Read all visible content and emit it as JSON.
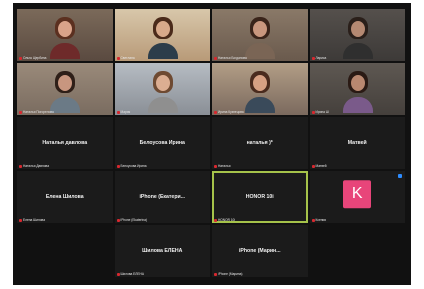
{
  "app": {
    "name": "Zoom gallery view"
  },
  "tiles": [
    {
      "type": "video",
      "name": "Ольга Щербина",
      "bg": "#5a4a40",
      "wall": "#7b6a5a",
      "hair": "#5b3020",
      "face": "#d9a38a",
      "shirt": "#6e2a2a"
    },
    {
      "type": "video",
      "name": "Светлана",
      "bg": "#b89a78",
      "wall": "#d8c7aa",
      "hair": "#4a2a1a",
      "face": "#d8a98a",
      "shirt": "#2c3d4a"
    },
    {
      "type": "video",
      "name": "Наталья Богданова",
      "bg": "#6a5a4d",
      "wall": "#8a7968",
      "hair": "#3a241a",
      "face": "#c9977e",
      "shirt": "#7a6555"
    },
    {
      "type": "video",
      "name": "Лариса",
      "bg": "#3d3a38",
      "wall": "#55504c",
      "hair": "#2a1f1a",
      "face": "#b58972",
      "shirt": "#2f2f2f"
    },
    {
      "type": "video",
      "name": "Наталья Погорелова",
      "bg": "#7a6c60",
      "wall": "#9a8a7a",
      "hair": "#2e1f18",
      "face": "#c8967f",
      "shirt": "#6b7a86"
    },
    {
      "type": "video",
      "name": "Мария",
      "bg": "#8a8f96",
      "wall": "#b6bcc3",
      "hair": "#6e4a32",
      "face": "#dcae92",
      "shirt": "#8f8f8f"
    },
    {
      "type": "video",
      "name": "Ирина Кузнецова",
      "bg": "#7b6a5e",
      "wall": "#b29e86",
      "hair": "#4a2b1e",
      "face": "#d7a184",
      "shirt": "#3a4a5a"
    },
    {
      "type": "video",
      "name": "Ирина Ш",
      "bg": "#45403c",
      "wall": "#5e5852",
      "hair": "#2a1a14",
      "face": "#b98870",
      "shirt": "#7a5a8a"
    },
    {
      "type": "name",
      "name": "Наталья Давлова",
      "label": "Наталья давлова"
    },
    {
      "type": "name",
      "name": "Белоусова Ирина",
      "label": "Белоусова Ирина"
    },
    {
      "type": "name",
      "name": "Наталья",
      "label": "наталья )*"
    },
    {
      "type": "name",
      "name": "Матвей",
      "label": "Матвей"
    },
    {
      "type": "name",
      "name": "Елена Шилова",
      "label": "Елена Шилова"
    },
    {
      "type": "name",
      "name": "iPhone (Ekaterina)",
      "label": "iPhone (Екатери..."
    },
    {
      "type": "name",
      "name": "HONOR 10i",
      "label": "HONOR 10i",
      "active": true
    },
    {
      "type": "avatar",
      "name": "Ксения",
      "letter": "K",
      "badge": true
    },
    {
      "type": "empty"
    },
    {
      "type": "name",
      "name": "Шилова ЕЛЕНА",
      "label": "Шилова ЕЛЕНА"
    },
    {
      "type": "name",
      "name": "iPhone (Марина)",
      "label": "iPhone (Марин..."
    },
    {
      "type": "empty"
    }
  ]
}
